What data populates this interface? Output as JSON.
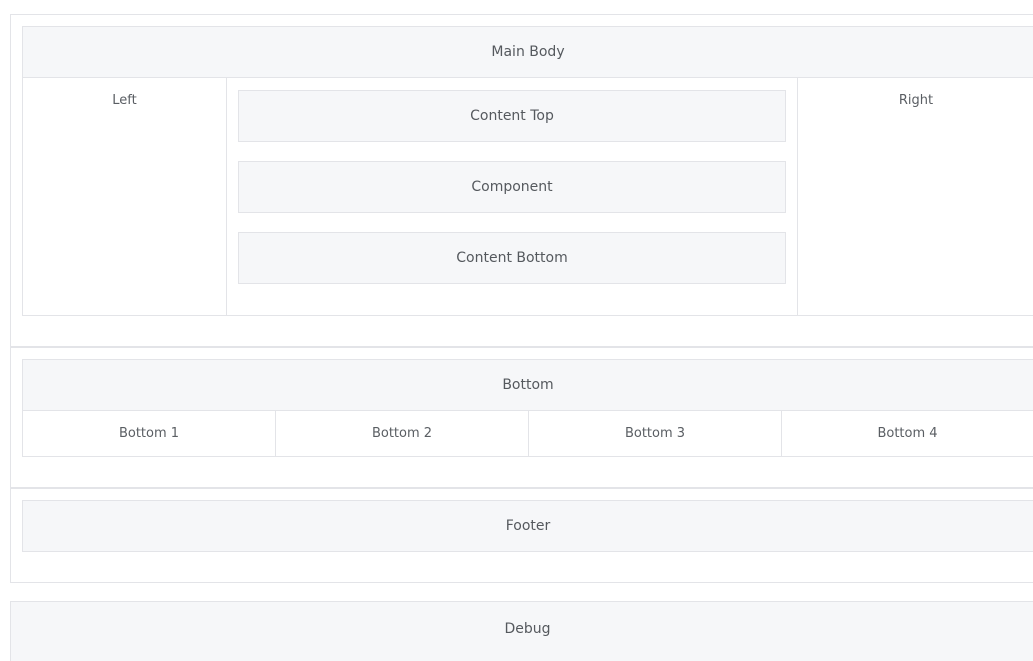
{
  "main_section": {
    "header": "Main Body",
    "left": "Left",
    "right": "Right",
    "content_top": "Content Top",
    "component": "Component",
    "content_bottom": "Content Bottom"
  },
  "bottom_section": {
    "header": "Bottom",
    "columns": [
      "Bottom 1",
      "Bottom 2",
      "Bottom 3",
      "Bottom 4"
    ]
  },
  "footer_section": {
    "label": "Footer"
  },
  "debug_section": {
    "label": "Debug"
  }
}
